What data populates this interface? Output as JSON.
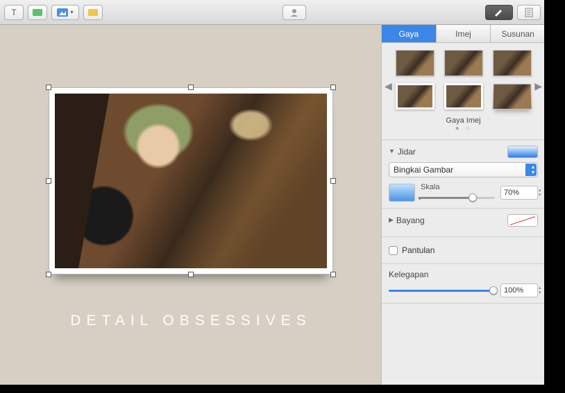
{
  "toolbar": {
    "text_tool": "T"
  },
  "canvas": {
    "caption": "DETAIL OBSESSIVES"
  },
  "inspector": {
    "tabs": {
      "style": "Gaya",
      "image": "Imej",
      "arrange": "Susunan"
    },
    "styles_label": "Gaya Imej",
    "border": {
      "title": "Jidar",
      "select": "Bingkai Gambar",
      "scale_label": "Skala",
      "scale_value": "70%"
    },
    "shadow": {
      "title": "Bayang"
    },
    "reflection": {
      "label": "Pantulan"
    },
    "opacity": {
      "label": "Kelegapan",
      "value": "100%"
    }
  }
}
